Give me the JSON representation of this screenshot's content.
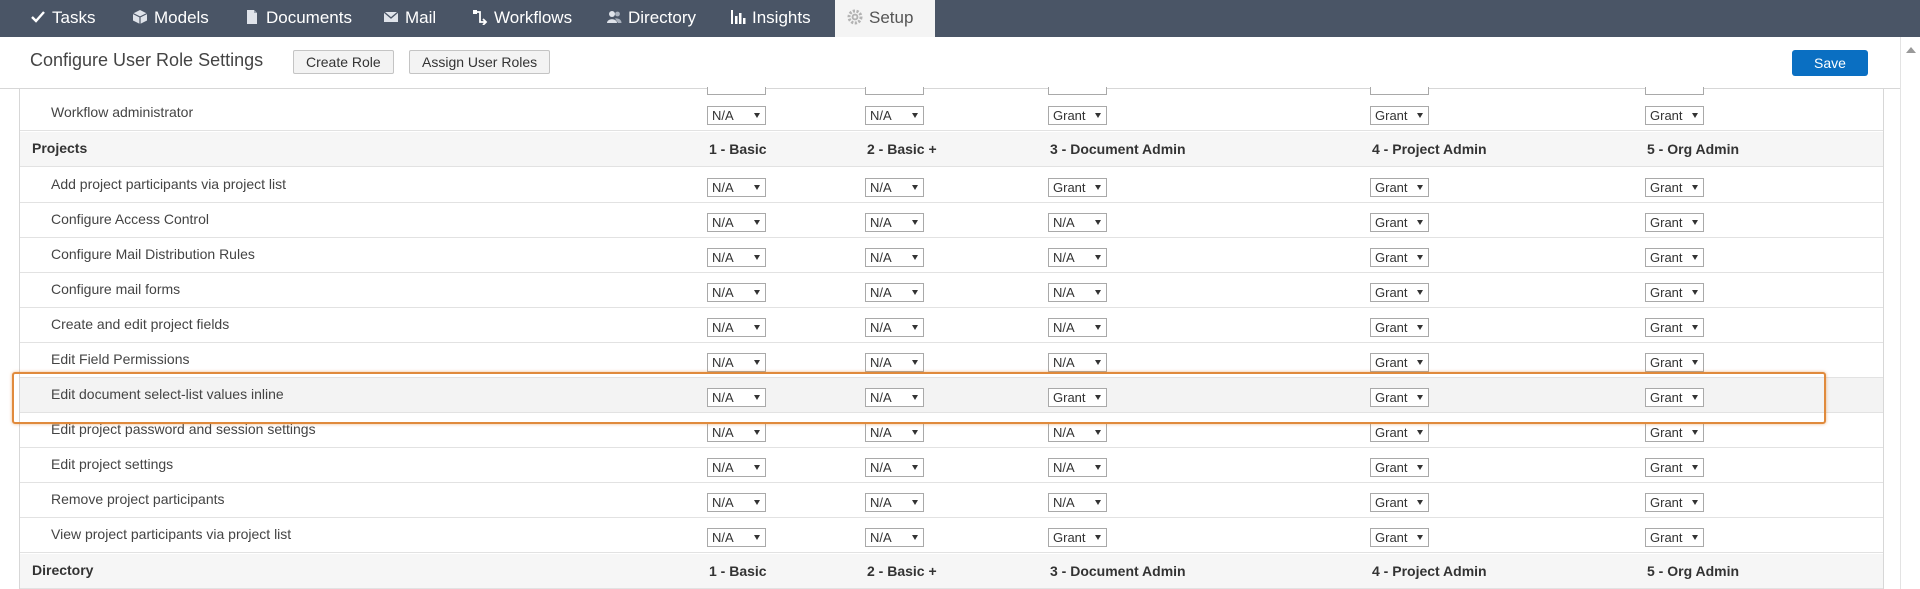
{
  "nav": [
    {
      "label": "Tasks",
      "icon": "check-icon"
    },
    {
      "label": "Models",
      "icon": "cube-icon"
    },
    {
      "label": "Documents",
      "icon": "document-icon"
    },
    {
      "label": "Mail",
      "icon": "mail-icon"
    },
    {
      "label": "Workflows",
      "icon": "workflow-icon"
    },
    {
      "label": "Directory",
      "icon": "people-icon"
    },
    {
      "label": "Insights",
      "icon": "bar-chart-icon"
    },
    {
      "label": "Setup",
      "icon": "gear-icon",
      "active": true
    }
  ],
  "toolbar": {
    "title": "Configure User Role Settings",
    "create_role": "Create Role",
    "assign_roles": "Assign User Roles",
    "save": "Save"
  },
  "columns": [
    "1 - Basic",
    "2 - Basic +",
    "3 - Document Admin",
    "4 - Project Admin",
    "5 - Org Admin"
  ],
  "rows": [
    {
      "type": "item",
      "label": "Workflow administrator",
      "values": [
        "N/A",
        "N/A",
        "Grant",
        "Grant",
        "Grant"
      ]
    },
    {
      "type": "header",
      "label": "Projects"
    },
    {
      "type": "item",
      "label": "Add project participants via project list",
      "values": [
        "N/A",
        "N/A",
        "Grant",
        "Grant",
        "Grant"
      ]
    },
    {
      "type": "item",
      "label": "Configure Access Control",
      "values": [
        "N/A",
        "N/A",
        "N/A",
        "Grant",
        "Grant"
      ]
    },
    {
      "type": "item",
      "label": "Configure Mail Distribution Rules",
      "values": [
        "N/A",
        "N/A",
        "N/A",
        "Grant",
        "Grant"
      ]
    },
    {
      "type": "item",
      "label": "Configure mail forms",
      "values": [
        "N/A",
        "N/A",
        "N/A",
        "Grant",
        "Grant"
      ]
    },
    {
      "type": "item",
      "label": "Create and edit project fields",
      "values": [
        "N/A",
        "N/A",
        "N/A",
        "Grant",
        "Grant"
      ]
    },
    {
      "type": "item",
      "label": "Edit Field Permissions",
      "values": [
        "N/A",
        "N/A",
        "N/A",
        "Grant",
        "Grant"
      ]
    },
    {
      "type": "item",
      "label": "Edit document select-list values inline",
      "values": [
        "N/A",
        "N/A",
        "Grant",
        "Grant",
        "Grant"
      ],
      "highlighted": true
    },
    {
      "type": "item",
      "label": "Edit project password and session settings",
      "values": [
        "N/A",
        "N/A",
        "N/A",
        "Grant",
        "Grant"
      ]
    },
    {
      "type": "item",
      "label": "Edit project settings",
      "values": [
        "N/A",
        "N/A",
        "N/A",
        "Grant",
        "Grant"
      ]
    },
    {
      "type": "item",
      "label": "Remove project participants",
      "values": [
        "N/A",
        "N/A",
        "N/A",
        "Grant",
        "Grant"
      ]
    },
    {
      "type": "item",
      "label": "View project participants via project list",
      "values": [
        "N/A",
        "N/A",
        "Grant",
        "Grant",
        "Grant"
      ]
    },
    {
      "type": "header",
      "label": "Directory"
    }
  ],
  "colors": {
    "nav_bg": "#4a5566",
    "save_bg": "#0a6fc2",
    "highlight": "#e08a3c"
  }
}
